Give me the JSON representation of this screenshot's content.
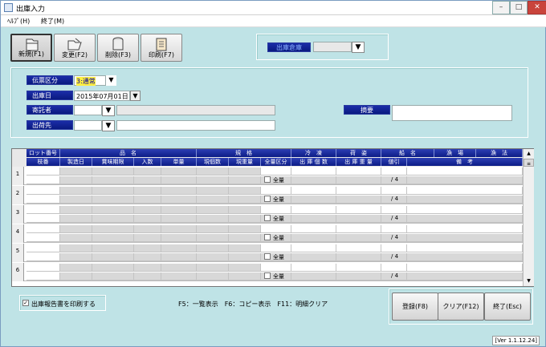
{
  "window": {
    "title": "出庫入力",
    "min": "–",
    "max": "□",
    "close": "✕"
  },
  "menu": {
    "help": "ﾍﾙﾌﾟ(H)",
    "exit": "終了(M)"
  },
  "toolbar": [
    {
      "label": "新規(F1)",
      "icon": "folder-open-icon"
    },
    {
      "label": "変更(F2)",
      "icon": "folder-edit-icon"
    },
    {
      "label": "削除(F3)",
      "icon": "trash-icon"
    },
    {
      "label": "印刷(F7)",
      "icon": "clipboard-print-icon"
    }
  ],
  "warehouse": {
    "label": "出庫倉庫",
    "value": ""
  },
  "form": {
    "slip_type_label": "伝票区分",
    "slip_type_value": "3:通常",
    "ship_date_label": "出庫日",
    "ship_date_value": "2015年07月01日",
    "consignor_label": "寄託者",
    "consignor_value": "",
    "destination_label": "出荷先",
    "destination_value": "",
    "memo_label": "摘要",
    "memo_value": ""
  },
  "grid": {
    "header1": [
      "ロット番号",
      "品　名",
      "規　格",
      "冷　凍",
      "荷　姿",
      "船　名",
      "漁　場",
      "漁　法"
    ],
    "header2": [
      "枝番",
      "製造日",
      "賞味期限",
      "入数",
      "単量",
      "現個数",
      "現重量",
      "全量区分",
      "出 庫 個 数",
      "出 庫 重 量",
      "値引",
      "備　考"
    ],
    "rows": [
      {
        "num": "1",
        "all_label": "全量",
        "ratio": "/ 4"
      },
      {
        "num": "2",
        "all_label": "全量",
        "ratio": "/ 4"
      },
      {
        "num": "3",
        "all_label": "全量",
        "ratio": "/ 4"
      },
      {
        "num": "4",
        "all_label": "全量",
        "ratio": "/ 4"
      },
      {
        "num": "5",
        "all_label": "全量",
        "ratio": "/ 4"
      },
      {
        "num": "6",
        "all_label": "全量",
        "ratio": "/ 4"
      }
    ]
  },
  "print_option": {
    "label": "出庫報告書を印刷する",
    "checked": true
  },
  "shortcuts": "F5：一覧表示　F6：コピー表示　F11：明細クリア",
  "buttons": {
    "register": "登録(F8)",
    "clear": "クリア(F12)",
    "exit": "終了(Esc)"
  },
  "version": "[Ver 1.1.12.24]"
}
